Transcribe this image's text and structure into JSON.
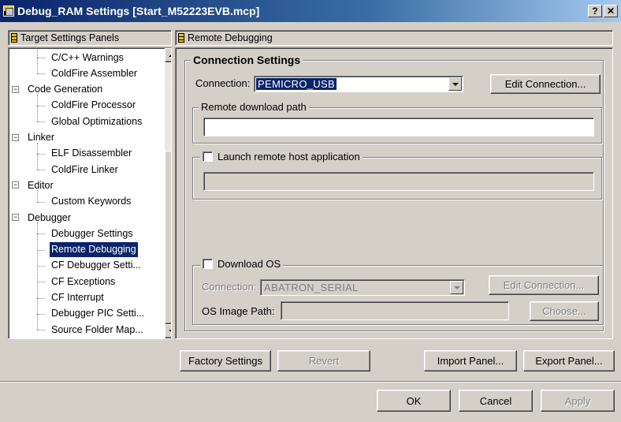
{
  "window": {
    "title": "Debug_RAM Settings [Start_M52223EVB.mcp]",
    "help_label": "?",
    "close_label": "✕"
  },
  "left_panel": {
    "header": "Target Settings Panels",
    "tree": [
      {
        "label": "C/C++ Warnings",
        "level": 1
      },
      {
        "label": "ColdFire Assembler",
        "level": 1
      },
      {
        "label": "Code Generation",
        "level": 0,
        "expander": "−"
      },
      {
        "label": "ColdFire Processor",
        "level": 1
      },
      {
        "label": "Global Optimizations",
        "level": 1
      },
      {
        "label": "Linker",
        "level": 0,
        "expander": "−"
      },
      {
        "label": "ELF Disassembler",
        "level": 1
      },
      {
        "label": "ColdFire Linker",
        "level": 1
      },
      {
        "label": "Editor",
        "level": 0,
        "expander": "−"
      },
      {
        "label": "Custom Keywords",
        "level": 1
      },
      {
        "label": "Debugger",
        "level": 0,
        "expander": "−"
      },
      {
        "label": "Debugger Settings",
        "level": 1
      },
      {
        "label": "Remote Debugging",
        "level": 1,
        "selected": true
      },
      {
        "label": "CF Debugger Setti...",
        "level": 1
      },
      {
        "label": "CF Exceptions",
        "level": 1
      },
      {
        "label": "CF Interrupt",
        "level": 1
      },
      {
        "label": "Debugger PIC Setti...",
        "level": 1
      },
      {
        "label": "Source Folder Map...",
        "level": 1
      }
    ]
  },
  "right_panel": {
    "header": "Remote Debugging",
    "connection_settings": {
      "legend": "Connection Settings",
      "connection_label": "Connection:",
      "connection_value": "PEMICRO_USB",
      "edit_connection": "Edit Connection...",
      "remote_download_path_legend": "Remote download path",
      "remote_download_path_value": "",
      "launch_remote_legend": "Launch remote host application",
      "launch_remote_value": ""
    },
    "download_os": {
      "legend": "Download OS",
      "connection_label": "Connection:",
      "connection_value": "ABATRON_SERIAL",
      "edit_connection": "Edit Connection...",
      "os_image_path_label": "OS Image Path:",
      "os_image_path_value": "",
      "choose": "Choose..."
    }
  },
  "panel_buttons": {
    "factory_settings": "Factory Settings",
    "revert": "Revert",
    "import_panel": "Import Panel...",
    "export_panel": "Export Panel..."
  },
  "dialog_buttons": {
    "ok": "OK",
    "cancel": "Cancel",
    "apply": "Apply"
  },
  "colors": {
    "face": "#d4d0c8",
    "selection": "#0a246a",
    "title_gradient_start": "#0a246a",
    "title_gradient_end": "#a6caf0"
  }
}
